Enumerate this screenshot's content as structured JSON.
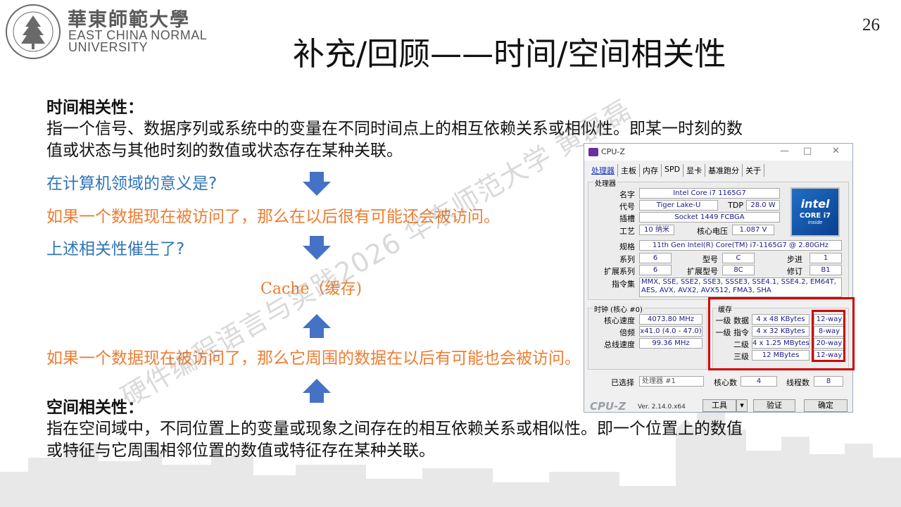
{
  "header": {
    "logo_cn": "華東師範大學",
    "logo_en_line1": "EAST CHINA NORMAL",
    "logo_en_line2": "UNIVERSITY",
    "title": "补充/回顾——时间/空间相关性",
    "page_number": "26"
  },
  "content": {
    "temporal_heading": "时间相关性：",
    "temporal_def_line1": "指一个信号、数据序列或系统中的变量在不同时间点上的相互依赖关系或相似性。即某一时刻的数",
    "temporal_def_line2": "值或状态与其他时刻的数值或状态存在某种关联。",
    "question1": "在计算机领域的意义是?",
    "answer1": "如果一个数据现在被访问了，那么在以后很有可能还会被访问。",
    "question2": "上述相关性催生了?",
    "cache_label": "Cache（缓存)",
    "answer2": "如果一个数据现在被访问了，那么它周围的数据在以后有可能也会被访问。",
    "spatial_heading": "空间相关性：",
    "spatial_def_line1": "指在空间域中，不同位置上的变量或现象之间存在的相互依赖关系或相似性。即一个位置上的数值",
    "spatial_def_line2": "或特征与它周围相邻位置的数值或特征存在某种关联。"
  },
  "watermark": "硬件编程语言与实践2026 华东师范大学 黄磊磊",
  "cpuz": {
    "window_title": "CPU-Z",
    "tabs": [
      "处理器",
      "主板",
      "内存",
      "SPD",
      "显卡",
      "基准跑分",
      "关于"
    ],
    "processor_group": "处理器",
    "labels": {
      "name": "名字",
      "codename": "代号",
      "tdp": "TDP",
      "package": "插槽",
      "technology": "工艺",
      "core_voltage": "核心电压",
      "spec": "规格",
      "family": "系列",
      "model": "型号",
      "stepping": "步进",
      "ext_family": "扩展系列",
      "ext_model": "扩展型号",
      "revision": "修订",
      "instructions": "指令集"
    },
    "values": {
      "name": "Intel Core i7 1165G7",
      "codename": "Tiger Lake-U",
      "tdp": "28.0 W",
      "package": "Socket 1449 FCBGA",
      "technology": "10 纳米",
      "core_voltage": "1.087 V",
      "spec": "11th Gen Intel(R) Core(TM) i7-1165G7 @ 2.80GHz",
      "family": "6",
      "model": "C",
      "stepping": "1",
      "ext_family": "6",
      "ext_model": "8C",
      "revision": "B1",
      "instructions": "MMX, SSE, SSE2, SSE3, SSSE3, SSE4.1, SSE4.2, EM64T, AES, AVX, AVX2, AVX512, FMA3, SHA"
    },
    "intel_badge": {
      "brand": "intel",
      "line": "CORE i7",
      "sub": "inside"
    },
    "clocks": {
      "group": "时钟 (核心 #0)",
      "core_speed_label": "核心速度",
      "core_speed": "4073.80 MHz",
      "multiplier_label": "倍频",
      "multiplier": "x41.0 (4.0 - 47.0)",
      "bus_speed_label": "总线速度",
      "bus_speed": "99.36 MHz"
    },
    "cache": {
      "group": "缓存",
      "rows": [
        {
          "label": "一级 数据",
          "size": "4 x 48 KBytes",
          "way": "12-way"
        },
        {
          "label": "一级 指令",
          "size": "4 x 32 KBytes",
          "way": "8-way"
        },
        {
          "label": "二级",
          "size": "4 x 1.25 MBytes",
          "way": "20-way"
        },
        {
          "label": "三级",
          "size": "12 MBytes",
          "way": "12-way"
        }
      ]
    },
    "selection": {
      "selected_label": "已选择",
      "selected_value": "处理器 #1",
      "cores_label": "核心数",
      "cores": "4",
      "threads_label": "线程数",
      "threads": "8"
    },
    "footer": {
      "logo": "CPU-Z",
      "version": "Ver. 2.14.0.x64",
      "tools_button": "工具",
      "validate_button": "验证",
      "ok_button": "确定"
    }
  }
}
